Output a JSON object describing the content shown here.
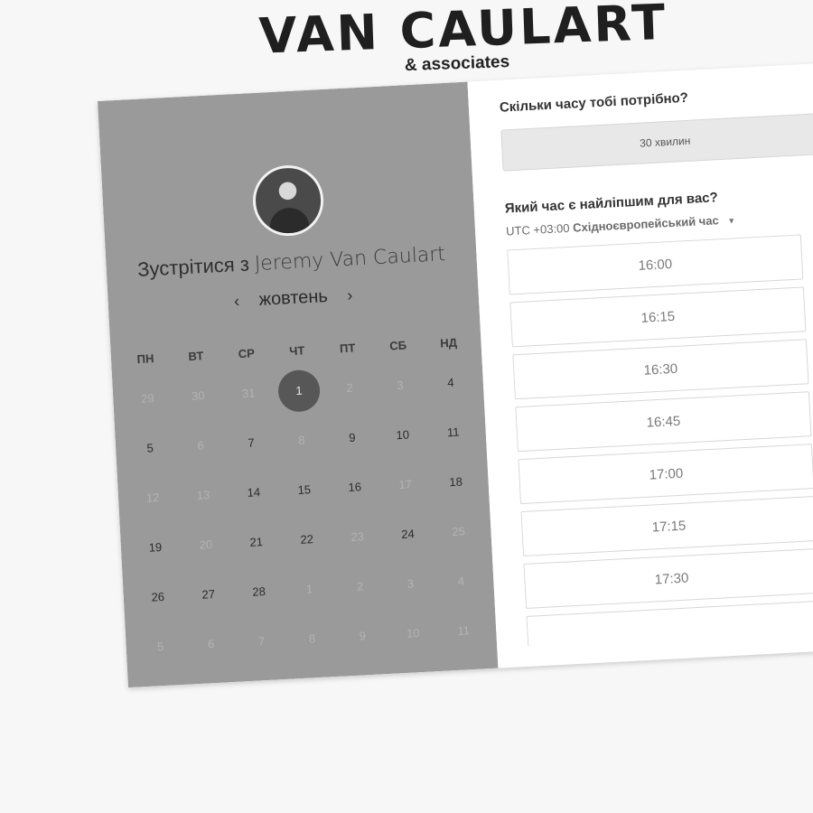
{
  "brand": {
    "title": "VAN CAULART",
    "subtitle": "& associates"
  },
  "host": {
    "meet_prefix": "Зустрітися з",
    "name": "Jeremy Van Caulart"
  },
  "calendar": {
    "month": "жовтень",
    "prev_icon": "chevron-left-icon",
    "next_icon": "chevron-right-icon",
    "weekdays": [
      "ПН",
      "ВТ",
      "СР",
      "ЧТ",
      "ПТ",
      "СБ",
      "НД"
    ],
    "weeks": [
      [
        "29",
        "30",
        "31",
        "1",
        "2",
        "3",
        "4"
      ],
      [
        "5",
        "6",
        "7",
        "8",
        "9",
        "10",
        "11"
      ],
      [
        "12",
        "13",
        "14",
        "15",
        "16",
        "17",
        "18"
      ],
      [
        "19",
        "20",
        "21",
        "22",
        "23",
        "24",
        "25"
      ],
      [
        "26",
        "27",
        "28",
        "1",
        "2",
        "3",
        "4"
      ],
      [
        "5",
        "6",
        "7",
        "8",
        "9",
        "10",
        "11"
      ]
    ],
    "selected_day": "1"
  },
  "booking": {
    "duration_question": "Скільки часу тобі потрібно?",
    "duration_value": "30 хвилин",
    "time_question": "Який час є найліпшим для вас?",
    "timezone_offset": "UTC +03:00",
    "timezone_name": "Східноєвропейський час",
    "slots": [
      "16:00",
      "16:15",
      "16:30",
      "16:45",
      "17:00",
      "17:15",
      "17:30",
      ""
    ]
  },
  "colors": {
    "left_panel": "#9a9a9a",
    "selected_day": "#575757"
  }
}
